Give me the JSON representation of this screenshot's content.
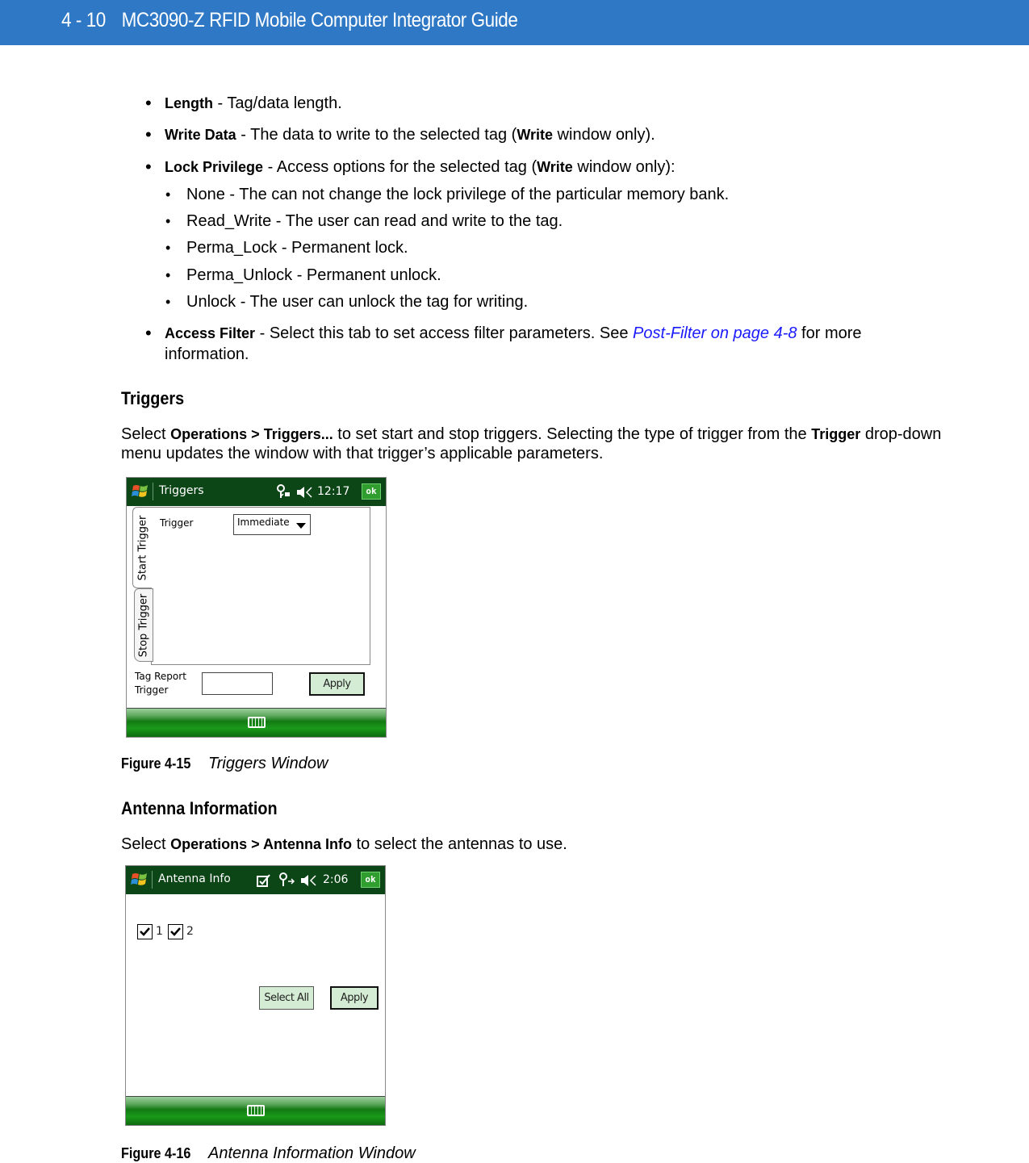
{
  "header": {
    "page_number": "4 - 10",
    "doc_title": "MC3090-Z RFID Mobile Computer Integrator Guide"
  },
  "bullets": [
    {
      "term": "Length",
      "text": " - Tag/data length."
    },
    {
      "term": "Write Data",
      "text_before": " - The data to write to the selected tag (",
      "bold_inline": "Write",
      "text_after": " window only)."
    },
    {
      "term": "Lock Privilege",
      "text_before": " - Access options for the selected tag (",
      "bold_inline": "Write",
      "text_after": " window only):",
      "sub_items": [
        "None - The can not change the lock privilege of the particular memory bank.",
        "Read_Write - The user can read and write to the tag.",
        "Perma_Lock - Permanent lock.",
        "Perma_Unlock - Permanent unlock.",
        "Unlock - The user can unlock the tag for writing."
      ]
    },
    {
      "term": "Access Filter",
      "text_before": " - Select this tab to set access filter parameters. See ",
      "link": "Post-Filter on page 4-8",
      "text_after": " for more",
      "text_line2": "information."
    }
  ],
  "triggers_section": {
    "heading": "Triggers",
    "para_select": "Select ",
    "para_menu": "Operations > Triggers...",
    "para_mid": " to set start and stop triggers. Selecting the type of trigger from the ",
    "para_bold2": "Trigger",
    "para_end": " drop-down",
    "para_line2": "menu updates the window with that trigger’s applicable parameters."
  },
  "triggers_window": {
    "title": "Triggers",
    "time": "12:17",
    "ok_label": "ok",
    "tabs": [
      "Start Trigger",
      "Stop Trigger"
    ],
    "active_tab": "Start Trigger",
    "trigger_label": "Trigger",
    "trigger_value": "Immediate",
    "tag_report_label_1": "Tag Report",
    "tag_report_label_2": "Trigger",
    "tag_report_value": "",
    "apply_label": "Apply",
    "icons": [
      "windows-start-icon",
      "connectivity-icon",
      "volume-icon",
      "keyboard-icon"
    ]
  },
  "figure_15": {
    "number": "Figure 4-15",
    "title": "Triggers Window"
  },
  "antenna_section": {
    "heading": "Antenna Information",
    "para_select": "Select ",
    "para_menu": "Operations > Antenna Info",
    "para_end": " to select the antennas to use."
  },
  "antenna_window": {
    "title": "Antenna Info",
    "time": "2:06",
    "ok_label": "ok",
    "antennas": [
      {
        "label": "1",
        "checked": true
      },
      {
        "label": "2",
        "checked": true
      }
    ],
    "select_all_label": "Select All",
    "apply_label": "Apply",
    "icons": [
      "windows-start-icon",
      "checkbox-tray-icon",
      "connectivity-icon",
      "volume-icon",
      "keyboard-icon"
    ]
  },
  "figure_16": {
    "number": "Figure 4-16",
    "title": "Antenna Information Window"
  }
}
